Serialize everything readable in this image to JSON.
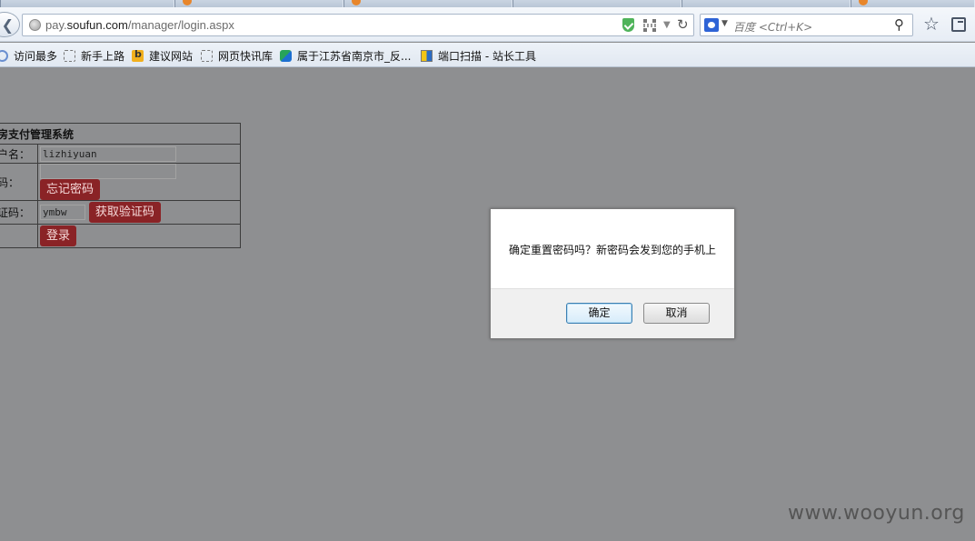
{
  "browser": {
    "url": {
      "prefix": "pay.",
      "domain": "soufun.com",
      "path": "/manager/login.aspx"
    },
    "search_placeholder": "百度 <Ctrl+K>",
    "bookmarks": [
      {
        "label": "访问最多",
        "icon": "globe-icon"
      },
      {
        "label": "新手上路",
        "icon": "page-icon"
      },
      {
        "label": "建议网站",
        "icon": "bing-icon"
      },
      {
        "label": "网页快讯库",
        "icon": "page-icon"
      },
      {
        "label": "属于江苏省南京市_反...",
        "icon": "site-icon"
      },
      {
        "label": "端口扫描 - 站长工具",
        "icon": "tool-icon"
      }
    ]
  },
  "login": {
    "title": "房支付管理系统",
    "username_label": "户名：",
    "username_value": "lizhiyuan",
    "password_label": "码：",
    "password_value": "",
    "forgot_button": "忘记密码",
    "captcha_label": "证码：",
    "captcha_value": "ymbw",
    "get_captcha_button": "获取验证码",
    "login_button": "登录"
  },
  "dialog": {
    "message": "确定重置密码吗？新密码会发到您的手机上",
    "ok_label": "确定",
    "cancel_label": "取消"
  },
  "watermark": "www.wooyun.org",
  "colors": {
    "overlay": "#8e8f91",
    "button_red": "#8a2326",
    "dialog_primary_border": "#3c7fb1"
  }
}
